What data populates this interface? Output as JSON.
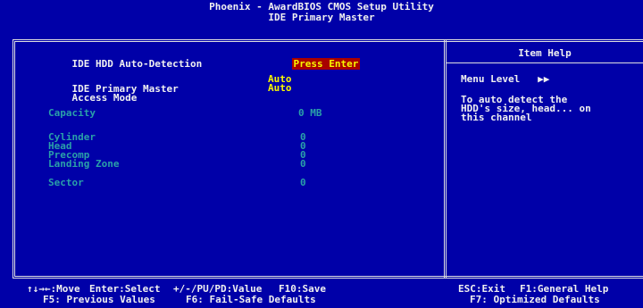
{
  "title": {
    "line1": "Phoenix - AwardBIOS CMOS Setup Utility",
    "line2": "IDE Primary Master"
  },
  "settings": {
    "auto_detection": {
      "label": "IDE HDD Auto-Detection",
      "value": "Press Enter"
    },
    "primary_master": {
      "label": "IDE Primary Master",
      "value": "Auto"
    },
    "access_mode": {
      "label": "Access Mode",
      "value": "Auto"
    },
    "capacity": {
      "label": "Capacity",
      "value": "0 MB"
    },
    "cylinder": {
      "label": "Cylinder",
      "value": "0"
    },
    "head": {
      "label": "Head",
      "value": "0"
    },
    "precomp": {
      "label": "Precomp",
      "value": "0"
    },
    "landing_zone": {
      "label": "Landing Zone",
      "value": "0"
    },
    "sector": {
      "label": "Sector",
      "value": "0"
    }
  },
  "help": {
    "title": "Item Help",
    "menu_level_label": "Menu Level",
    "menu_level_arrows": "▶▶",
    "line1": "To auto detect the",
    "line2": "HDD's size, head... on",
    "line3": "this channel"
  },
  "footer": {
    "row1": {
      "move": "↑↓→←:Move",
      "enter": "Enter:Select",
      "value": "+/-/PU/PD:Value",
      "save": "F10:Save",
      "exit": "ESC:Exit",
      "general_help": "F1:General Help"
    },
    "row2": {
      "previous": "F5: Previous Values",
      "failsafe": "F6: Fail-Safe Defaults",
      "optimized": "F7: Optimized Defaults"
    }
  },
  "colors": {
    "background": "#0000a8",
    "text": "#f0f0f0",
    "value_yellow": "#f8f800",
    "disabled_cyan": "#2aa0a8",
    "highlight_red": "#a80000"
  }
}
